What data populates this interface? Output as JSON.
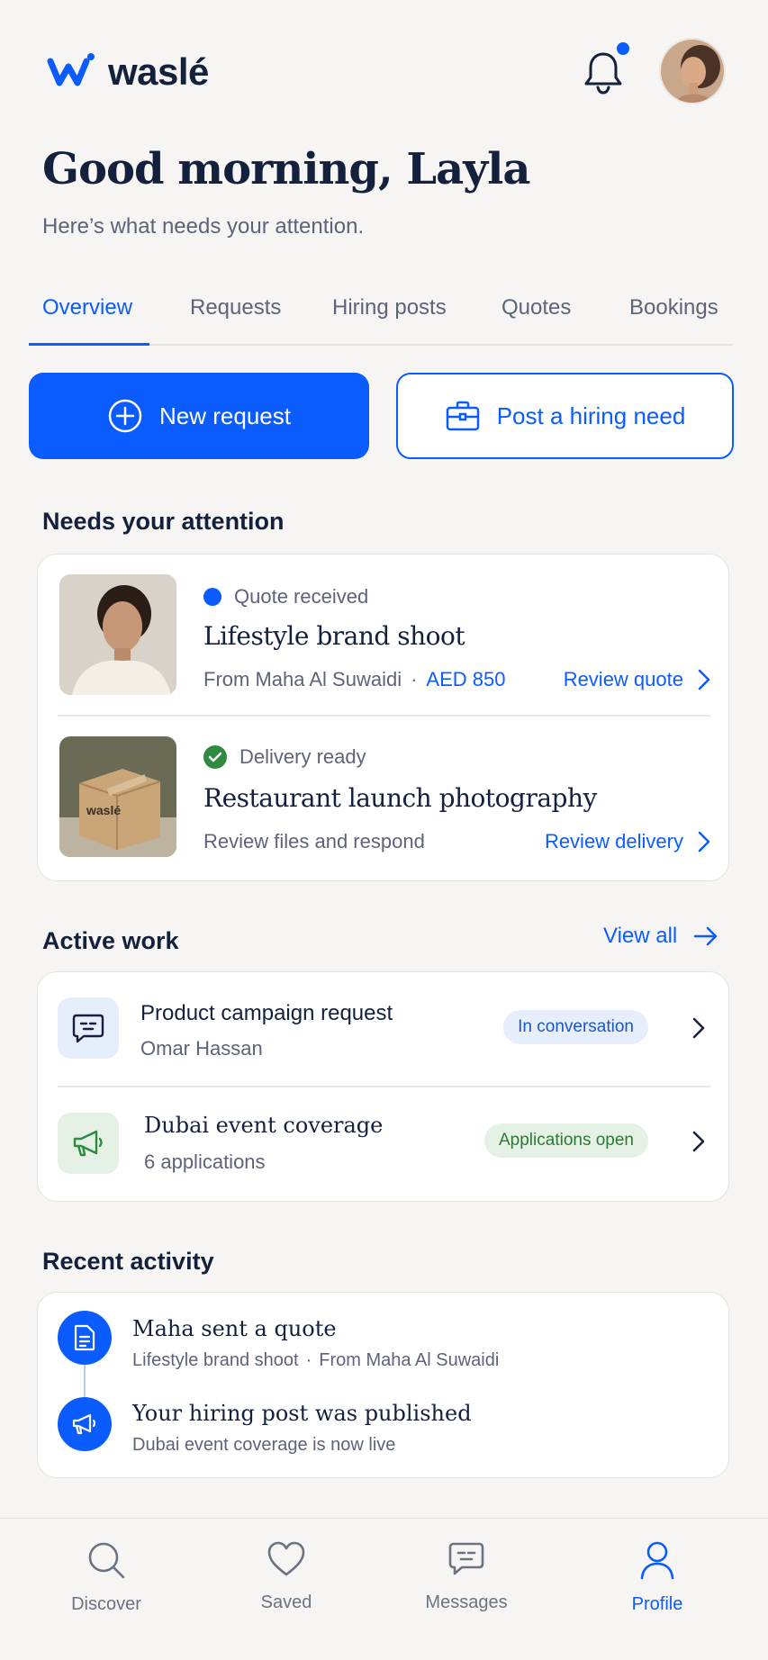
{
  "brand": {
    "name": "waslé"
  },
  "header": {
    "notification_icon": "bell-icon",
    "has_unread": true,
    "avatar_alt": "user-avatar"
  },
  "greeting": {
    "title": "Good morning, Layla",
    "subtitle": "Here’s what needs your attention."
  },
  "tabs": [
    {
      "label": "Overview",
      "active": true
    },
    {
      "label": "Requests",
      "active": false
    },
    {
      "label": "Hiring posts",
      "active": false
    },
    {
      "label": "Quotes",
      "active": false
    },
    {
      "label": "Bookings",
      "active": false
    }
  ],
  "actions": {
    "new_request": {
      "label": "New request",
      "icon": "plus-circle-icon"
    },
    "post_hiring": {
      "label": "Post a hiring need",
      "icon": "briefcase-icon"
    }
  },
  "attention": {
    "title": "Needs your attention",
    "items": [
      {
        "status": "Quote received",
        "status_icon": "blue-dot",
        "title": "Lifestyle brand shoot",
        "from": "From Maha Al Suwaidi",
        "separator": "·",
        "price": "AED 850",
        "link": "Review quote"
      },
      {
        "status": "Delivery ready",
        "status_icon": "check-icon",
        "title": "Restaurant launch photography",
        "subtitle": "Review files and respond",
        "link": "Review delivery",
        "box_label": "waslé"
      }
    ]
  },
  "active_work": {
    "title": "Active work",
    "view_all": "View all",
    "items": [
      {
        "title": "Product campaign request",
        "subtitle": "Omar Hassan",
        "badge": "In conversation",
        "icon": "chat-bubble-icon"
      },
      {
        "title": "Dubai event coverage",
        "subtitle": "6 applications",
        "badge": "Applications open",
        "icon": "megaphone-icon"
      }
    ]
  },
  "recent_activity": {
    "title": "Recent activity",
    "items": [
      {
        "title": "Maha sent a quote",
        "subtitle_a": "Lifestyle brand shoot",
        "separator": "·",
        "subtitle_b": "From Maha Al Suwaidi",
        "icon": "document-icon"
      },
      {
        "title": "Your hiring post was published",
        "subtitle": "Dubai event coverage is now live",
        "icon": "megaphone-icon"
      }
    ]
  },
  "bottom_nav": [
    {
      "label": "Discover",
      "icon": "search-icon",
      "active": false
    },
    {
      "label": "Saved",
      "icon": "heart-icon",
      "active": false
    },
    {
      "label": "Messages",
      "icon": "chat-bubble-icon",
      "active": false
    },
    {
      "label": "Profile",
      "icon": "user-icon",
      "active": true
    }
  ],
  "colors": {
    "accent": "#0b5cff",
    "text": "#14213d",
    "muted": "#5b6478",
    "background": "#f7f5f3",
    "success": "#2e8a3e"
  }
}
